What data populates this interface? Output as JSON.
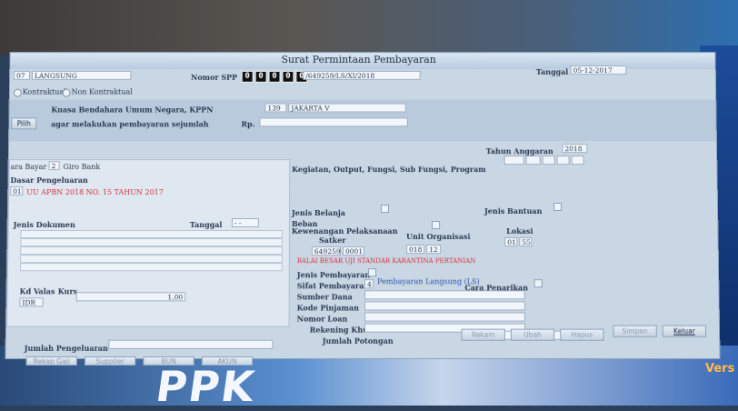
{
  "window": {
    "title": "Surat Permintaan Pembayaran"
  },
  "header": {
    "prefix": "07",
    "jenis": "LANGSUNG",
    "nomor_spp_label": "Nomor SPP",
    "nomor_spp_digits": [
      "0",
      "0",
      "0",
      "0",
      "0"
    ],
    "nomor_spp_suffix": "/649259/LS/XI/2018",
    "tanggal_label": "Tanggal",
    "tanggal_value": "05-12-2017"
  },
  "kontrak": {
    "opt1": "Kontraktual",
    "opt2": "Non Kontraktual"
  },
  "kuasa": {
    "line1": "Kuasa Bendahara Umum Negara, KPPN",
    "line2": "agar melakukan pembayaran sejumlah",
    "rp": "Rp.",
    "kppn_code": "139",
    "kppn_name": "JAKARTA V",
    "pilih": "Pilih"
  },
  "tahun": {
    "label": "Tahun Anggaran",
    "value": "2018"
  },
  "left": {
    "cara_bayar_label": "ara Bayar",
    "cara_bayar_code": "2",
    "cara_bayar_name": "Giro Bank",
    "dasar_label": "Dasar Pengeluaran",
    "dasar_code": "01",
    "dasar_text": "UU APBN 2018 NO. 15 TAHUN 2017",
    "jenis_dok_label": "Jenis Dokumen",
    "tanggal_label": "Tanggal",
    "tanggal_value": "- -",
    "kd_valas_label": "Kd Valas",
    "kurs_label": "Kurs",
    "valas_value": "IDR",
    "kurs_value": "1,00"
  },
  "right": {
    "kegiatan_label": "Kegiatan, Output, Fungsi, Sub Fungsi, Program",
    "jenis_belanja_label": "Jenis Belanja",
    "jenis_bantuan_label": "Jenis Bantuan",
    "beban_label": "Beban",
    "kewenangan_label": "Kewenangan Pelaksanaan",
    "satker_label": "Satker",
    "unit_label": "Unit Organisasi",
    "lokasi_label": "Lokasi",
    "satker_code": "649259",
    "satker_sub": "0001",
    "unit_code1": "018",
    "unit_code2": "12",
    "lokasi_code1": "01",
    "lokasi_code2": "55",
    "satker_name": "BALAI BESAR UJI STANDAR KARANTINA PERTANIAN",
    "jenis_pembayaran_label": "Jenis Pembayaran",
    "sifat_label": "Sifat Pembayaran",
    "sifat_code": "4",
    "sifat_name": "Pembayaran Langsung (LS)",
    "cara_penarikan_label": "Cara Penarikan",
    "sumber_dana_label": "Sumber Dana",
    "kode_pinjaman_label": "Kode Pinjaman",
    "nomor_loan_label": "Nomor Loan",
    "rekening_label": "Rekening Khusus",
    "jumlah_potongan_label": "Jumlah Potongan"
  },
  "footer": {
    "jumlah_pengeluaran_label": "Jumlah Pengeluaran",
    "bottom_buttons": [
      "Rekap Gaji",
      "Supplier",
      "BUN",
      "AKUN"
    ],
    "action_buttons": [
      "Rekam",
      "Ubah",
      "Hapus",
      "Simpan",
      "Keluar"
    ]
  },
  "overlay": {
    "brand": "PPK",
    "side_text": "Vers"
  }
}
